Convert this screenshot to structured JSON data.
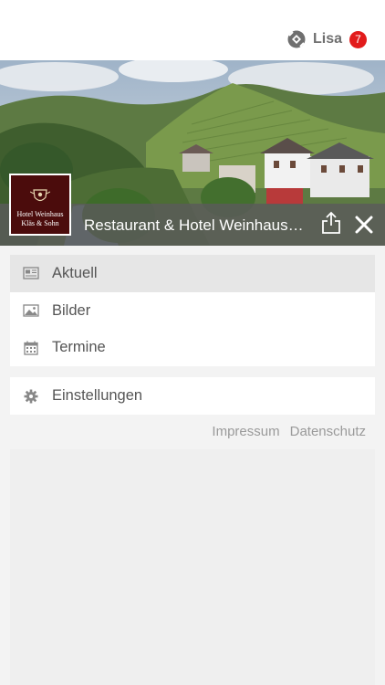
{
  "header": {
    "user_name": "Lisa",
    "notification_count": "7"
  },
  "hero": {
    "title": "Restaurant & Hotel Weinhaus Kläs & Sohn",
    "logo": {
      "line1": "Hotel Weinhaus",
      "line2": "Kläs & Sohn"
    }
  },
  "menu": {
    "items": [
      {
        "label": "Aktuell",
        "icon": "newspaper-icon",
        "active": true
      },
      {
        "label": "Bilder",
        "icon": "image-icon",
        "active": false
      },
      {
        "label": "Termine",
        "icon": "calendar-icon",
        "active": false
      }
    ],
    "settings_label": "Einstellungen"
  },
  "footer": {
    "impressum": "Impressum",
    "datenschutz": "Datenschutz"
  },
  "colors": {
    "badge": "#e21b1b",
    "logo_bg": "#4b0c0c",
    "title_bar": "#5a5a5a"
  }
}
